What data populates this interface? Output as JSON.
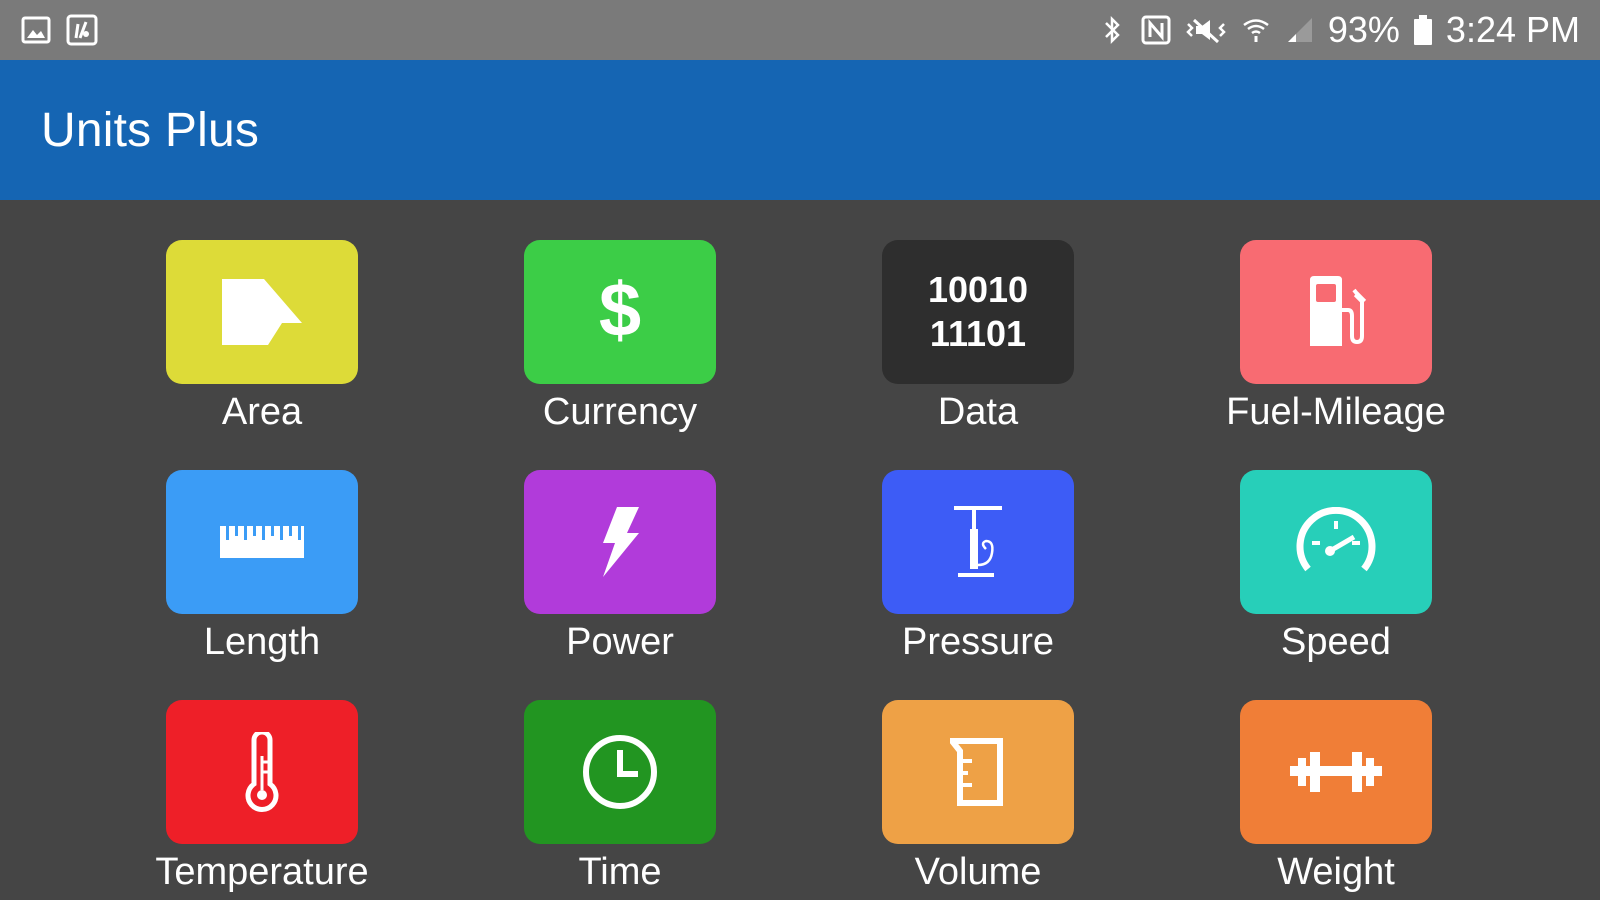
{
  "status_bar": {
    "battery_percent": "93%",
    "time": "3:24 PM",
    "icons": [
      "gallery-icon",
      "clipboard-icon",
      "bluetooth-icon",
      "nfc-icon",
      "vibrate-icon",
      "wifi-icon",
      "signal-icon",
      "battery-icon"
    ]
  },
  "app_bar": {
    "title": "Units Plus"
  },
  "categories": [
    {
      "label": "Area",
      "color": "#dddb38",
      "icon": "area-icon"
    },
    {
      "label": "Currency",
      "color": "#3ccd47",
      "icon": "dollar-icon"
    },
    {
      "label": "Data",
      "color": "#2e2e2e",
      "icon": "binary-icon",
      "icon_text": [
        "10010",
        "11101"
      ]
    },
    {
      "label": "Fuel-Mileage",
      "color": "#f86b72",
      "icon": "fuel-pump-icon"
    },
    {
      "label": "Length",
      "color": "#3b9cf6",
      "icon": "ruler-icon"
    },
    {
      "label": "Power",
      "color": "#b13bda",
      "icon": "lightning-icon"
    },
    {
      "label": "Pressure",
      "color": "#3d5cf6",
      "icon": "pump-icon"
    },
    {
      "label": "Speed",
      "color": "#27cfb9",
      "icon": "speedometer-icon"
    },
    {
      "label": "Temperature",
      "color": "#ee1f28",
      "icon": "thermometer-icon"
    },
    {
      "label": "Time",
      "color": "#229521",
      "icon": "clock-icon"
    },
    {
      "label": "Volume",
      "color": "#eea146",
      "icon": "beaker-icon"
    },
    {
      "label": "Weight",
      "color": "#f07e37",
      "icon": "dumbbell-icon"
    }
  ]
}
